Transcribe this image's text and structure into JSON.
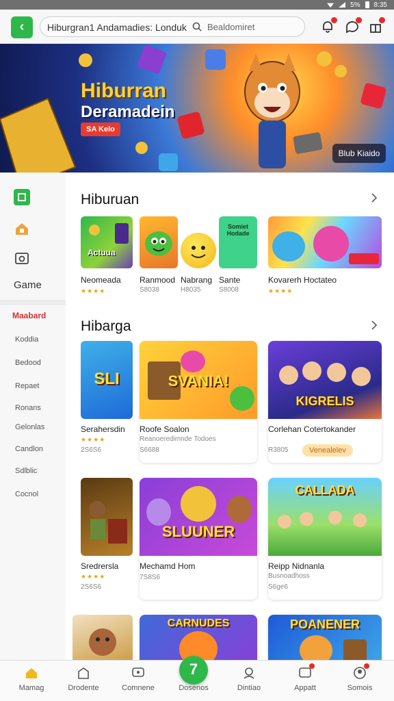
{
  "status_bar": {
    "time": "8:35",
    "battery": "5%"
  },
  "top_bar": {
    "search_value": "Hiburgran1 Andamadies: Londuk",
    "search_placeholder": "Bealdomiret"
  },
  "banner": {
    "title": "Hiburran",
    "subtitle": "Deramadein",
    "cta_label": "SA Kelo",
    "corner_label": "Blub Kiaido"
  },
  "sidebar": {
    "category_label": "Game",
    "subcategories": [
      "Maabard",
      "Koddia",
      "Bedood",
      "Repaet",
      "Ronans",
      "Gelonlas",
      "Candlon",
      "Sdlblic",
      "Cocnol"
    ]
  },
  "section1": {
    "title": "Hiburuan",
    "apps": [
      {
        "name": "Neomeada",
        "stars": "★★★★",
        "meta": "",
        "caption": "Actuua"
      },
      {
        "name": "Ranmood",
        "stars": "",
        "meta": "S8038",
        "caption": ""
      },
      {
        "name": "Nabrang",
        "stars": "",
        "meta": "H8035",
        "caption": ""
      },
      {
        "name": "Sante",
        "stars": "",
        "meta": "S8008",
        "caption": "Somiet Hodade"
      },
      {
        "name": "Kovarerh Hoctateo",
        "stars": "★★★★",
        "meta": "",
        "caption": ""
      }
    ]
  },
  "section2": {
    "title": "Hibarga",
    "cards": [
      {
        "thumb_title": "SLI",
        "name": "Serahersdin",
        "stars": "★★★★",
        "meta": "2S6S6",
        "badge": ""
      },
      {
        "thumb_title": "SVANIA!",
        "name": "Roofe Soalon",
        "stars": "",
        "meta": "Reanoeredimnde Todoes",
        "meta2": "S6688",
        "badge": ""
      },
      {
        "thumb_title": "KIGRELIS",
        "name": "Corlehan Cotertokander",
        "stars": "",
        "meta": "R3805",
        "badge": "Venealelev"
      },
      {
        "thumb_title": "",
        "name": "Sredrersla",
        "stars": "★★★★",
        "meta": "2S6S6",
        "badge": ""
      },
      {
        "thumb_title": "SLUUNER",
        "name": "Mechamd Hom",
        "stars": "",
        "meta": "7S8S6",
        "badge": ""
      },
      {
        "thumb_title": "CALLADA",
        "name": "Reipp Nidnanla",
        "stars": "",
        "meta": "Busnoadhoss",
        "meta2": "S6ge6",
        "badge": ""
      },
      {
        "thumb_title": "",
        "name": "",
        "stars": "",
        "meta": "",
        "badge": ""
      },
      {
        "thumb_title": "CARNUDES",
        "name": "",
        "stars": "",
        "meta": "",
        "badge": ""
      },
      {
        "thumb_title": "POANENER",
        "name": "",
        "stars": "",
        "meta": "",
        "badge": ""
      }
    ]
  },
  "bottom_nav": {
    "items": [
      "Mamag",
      "Drodente",
      "Comnene",
      "Dosenos",
      "Dintiao",
      "Appatt",
      "Somois"
    ],
    "center_label": "7"
  },
  "colors": {
    "accent": "#2fb84a",
    "badge": "#e52b2b",
    "active_category": "#d72f2f",
    "stars": "#e7a31e"
  }
}
